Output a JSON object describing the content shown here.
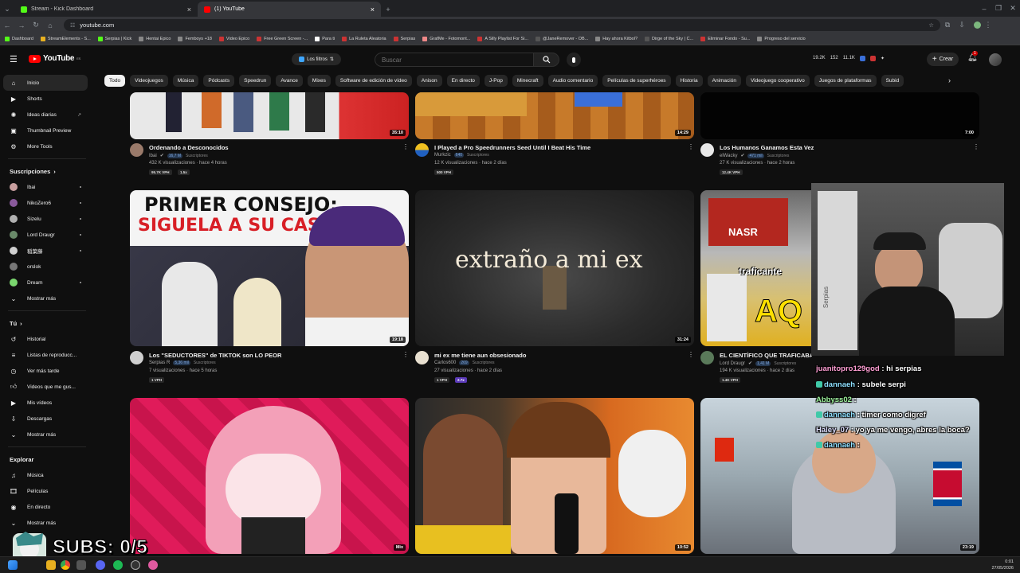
{
  "browser": {
    "tabs": [
      {
        "title": "Stream - Kick Dashboard",
        "active": false,
        "favicon_color": "#53fc18"
      },
      {
        "title": "(1) YouTube",
        "active": true,
        "favicon_color": "#ff0000"
      }
    ],
    "url": "youtube.com",
    "bookmarks": [
      "Dashboard",
      "StreamElements - S...",
      "Serpias | Kick",
      "Hentai Epico",
      "Femboys +18",
      "Video Epico",
      "Free Green Screen -...",
      "Para ti",
      "La Ruleta Aleatoria",
      "Serpias",
      "GrafMe - Fotomont...",
      "A Silly Playlist For Si...",
      "@JaneRemover - OB...",
      "Hay ahora Kitbol?",
      "Dirge of the Sky | C...",
      "Eliminar Fondo - Su...",
      "Progreso del servicio"
    ]
  },
  "header": {
    "logo_text": "YouTube",
    "logo_region": "ES",
    "filters_label": "Los filtros",
    "search_placeholder": "Buscar",
    "stats": [
      "19.2K",
      "152",
      "11.1K"
    ],
    "create_label": "Crear",
    "notification_count": "1"
  },
  "chips": [
    "Todo",
    "Videojuegos",
    "Música",
    "Pódcasts",
    "Speedrun",
    "Avance",
    "Mixes",
    "Software de edición de vídeo",
    "Anison",
    "En directo",
    "J-Pop",
    "Minecraft",
    "Audio comentario",
    "Películas de superhéroes",
    "Historia",
    "Animación",
    "Videojuego cooperativo",
    "Juegos de plataformas",
    "Subid"
  ],
  "sidebar": {
    "main": [
      {
        "label": "Inicio",
        "icon": "home-icon",
        "active": true
      },
      {
        "label": "Shorts",
        "icon": "shorts-icon"
      },
      {
        "label": "Ideas diarias",
        "icon": "ideas-icon"
      },
      {
        "label": "Thumbnail Preview",
        "icon": "thumbnail-icon"
      },
      {
        "label": "More Tools",
        "icon": "tools-icon"
      }
    ],
    "subs_title": "Suscripciones",
    "subscriptions": [
      {
        "label": "Ibai",
        "color": "#c9a0a0"
      },
      {
        "label": "NikoZero6",
        "color": "#8a5a9c"
      },
      {
        "label": "Sizelu",
        "color": "#b0b0b0"
      },
      {
        "label": "Lord Draugr",
        "color": "#6a8a6a"
      },
      {
        "label": "稲葉藤",
        "color": "#d0d0d0"
      },
      {
        "label": "orslok",
        "color": "#777777"
      },
      {
        "label": "Dream",
        "color": "#7ad66e"
      }
    ],
    "subs_more": "Mostrar más",
    "you_title": "Tú",
    "you": [
      {
        "label": "Historial",
        "icon": "history-icon"
      },
      {
        "label": "Listas de reproducc...",
        "icon": "playlist-icon"
      },
      {
        "label": "Ver más tarde",
        "icon": "clock-icon"
      },
      {
        "label": "Videos que me gus...",
        "icon": "thumbs-up-icon"
      },
      {
        "label": "Mis vídeos",
        "icon": "video-icon"
      },
      {
        "label": "Descargas",
        "icon": "download-icon"
      },
      {
        "label": "Mostrar más",
        "icon": "chevron-down-icon"
      }
    ],
    "explore_title": "Explorar",
    "explore": [
      {
        "label": "Música",
        "icon": "music-icon"
      },
      {
        "label": "Películas",
        "icon": "film-icon"
      },
      {
        "label": "En directo",
        "icon": "live-icon"
      },
      {
        "label": "Mostrar más",
        "icon": "chevron-down-icon"
      }
    ]
  },
  "videos": [
    {
      "title": "Ordenando a Desconocidos",
      "channel": "Ibai",
      "subs": "16,7 M",
      "subs_label": "Suscriptores",
      "meta": "432 K visualizaciones · hace 4 horas",
      "duration": "35:10",
      "vph": "95.7K VPH",
      "extra": "1.5x"
    },
    {
      "title": "I Played a Pro Speedrunners Seed Until I Beat His Time",
      "channel": "Murkzic",
      "subs": "640",
      "subs_label": "Suscriptores",
      "meta": "12 K visualizaciones · hace 2 días",
      "duration": "14:29",
      "vph": "500 VPH",
      "extra": ""
    },
    {
      "title": "Los Humanos Ganamos Esta Vez",
      "channel": "elWacky",
      "subs": "471 mil",
      "subs_label": "Suscriptores",
      "meta": "27 K visualizaciones · hace 2 horas",
      "duration": "7:00",
      "vph": "12.4K VPH",
      "extra": ""
    },
    {
      "title": "Los \"SEDUCTORES\" de TIKTOK son LO PEOR",
      "channel": "Serpias R",
      "subs": "5,36 mil",
      "subs_label": "Suscriptores",
      "meta": "7 visualizaciones · hace 5 horas",
      "duration": "19:18",
      "vph": "1 VPH",
      "extra": "",
      "thumb_lines": [
        "PRIMER CONSEJO:",
        "SIGUELA A SU CASA"
      ]
    },
    {
      "title": "mi ex me tiene aun obsesionado",
      "channel": "Carlos600",
      "subs": "269",
      "subs_label": "Suscriptores",
      "meta": "27 visualizaciones · hace 2 días",
      "duration": "31:24",
      "vph": "1 VPH",
      "extra": "2.7x",
      "thumb_lines": [
        "extraño a mi ex"
      ]
    },
    {
      "title": "EL CIENTÍFICO QUE TRAFICABA",
      "channel": "Lord Draugr",
      "subs": "1,41 M",
      "subs_label": "Suscriptores",
      "meta": "194 K visualizaciones · hace 2 días",
      "duration": "",
      "vph": "1.4K VPH",
      "extra": "",
      "thumb_lines": [
        "NASR",
        "traficante",
        "AQ"
      ]
    },
    {
      "title": "",
      "channel": "",
      "duration": "Mix"
    },
    {
      "title": "",
      "channel": "",
      "duration": "10:52"
    },
    {
      "title": "",
      "channel": "",
      "duration": "23:19"
    }
  ],
  "chat": [
    {
      "user": "juanitopro129god",
      "message": ": hi serpias",
      "badge": false
    },
    {
      "user": "dannaeh",
      "message": ": subele serpi",
      "badge": true
    },
    {
      "user": "Abbyss02",
      "message": ":",
      "badge": false
    },
    {
      "user": "dannaeh",
      "message": ": timer como digref",
      "badge": true
    },
    {
      "user": "Haley_07",
      "message": ": yo ya me vengo, abres la boca?",
      "badge": false
    },
    {
      "user": "dannaeh",
      "message": ":",
      "badge": true
    }
  ],
  "overlay": {
    "subs_counter": "SUBS: 0/5",
    "webcam_shirt_text": "Serpias"
  },
  "taskbar": {
    "time": "0:01",
    "date": "27/05/2026"
  }
}
